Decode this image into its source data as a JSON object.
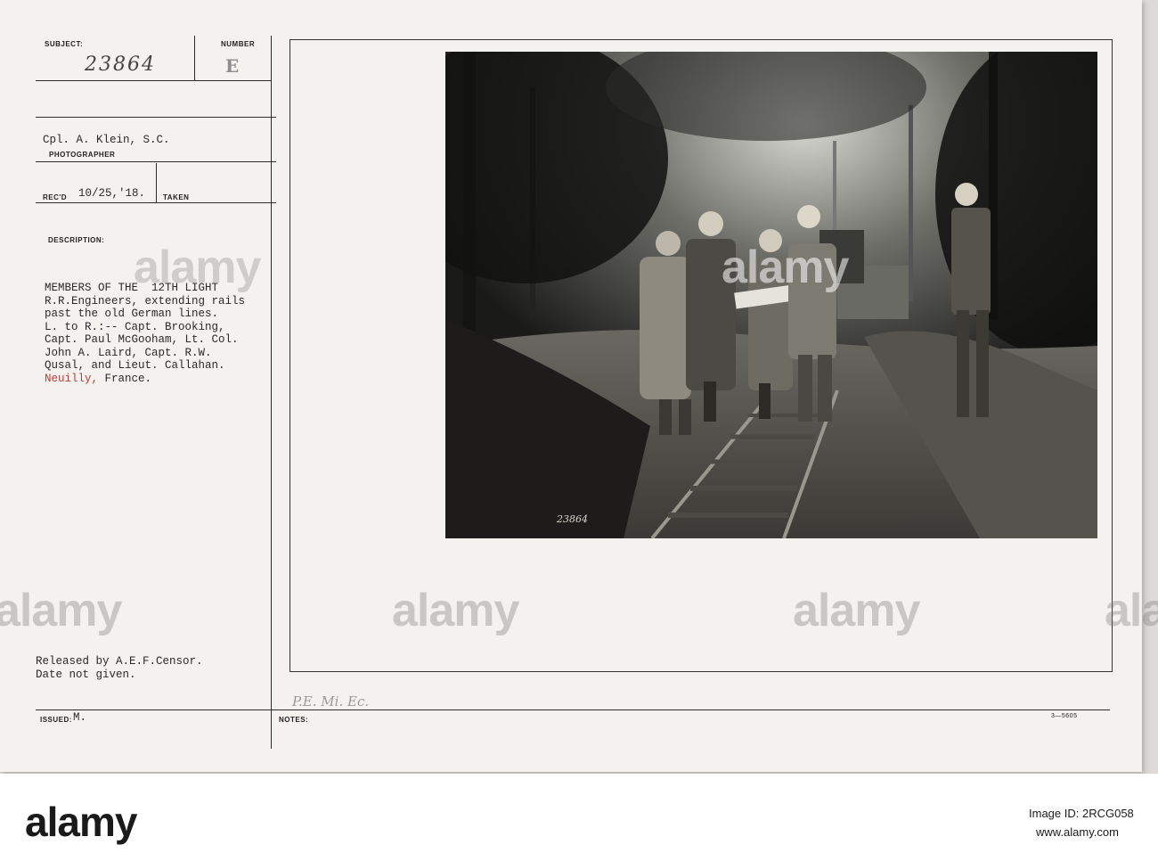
{
  "form": {
    "subject_label": "SUBJECT:",
    "subject_value": "23864",
    "number_label": "NUMBER",
    "number_value": "E",
    "photographer_value": "Cpl. A. Klein, S.C.",
    "photographer_label": "PHOTOGRAPHER",
    "recd_label": "REC'D",
    "recd_value": "10/25,'18.",
    "taken_label": "TAKEN",
    "description_label": "DESCRIPTION:",
    "description_lines": [
      "MEMBERS OF THE  12TH LIGHT",
      "R.R.Engineers, extending rails",
      "past the old German lines.",
      "L. to R.:-- Capt. Brooking,",
      "Capt. Paul McGooham, Lt. Col.",
      "John A. Laird, Capt. R.W.",
      "Qusal, and Lieut. Callahan."
    ],
    "location_red": "Neuilly,",
    "location_rest": " France.",
    "released_line1": "Released by A.E.F.Censor.",
    "released_line2": "Date not given.",
    "issued_label": "ISSUED:",
    "issued_value": "M.",
    "notes_label": "NOTES:",
    "notes_hand": "P.E. Mi. Ec.",
    "form_code": "3—5605"
  },
  "photo": {
    "negative_number": "23864",
    "scene": "five soldiers standing on narrow-gauge rails in a forest reading a map"
  },
  "watermark": {
    "text": "alamy"
  },
  "stock_strip": {
    "logo": "alamy",
    "image_id_label": "Image ID: 2RCG058",
    "url": "www.alamy.com"
  }
}
